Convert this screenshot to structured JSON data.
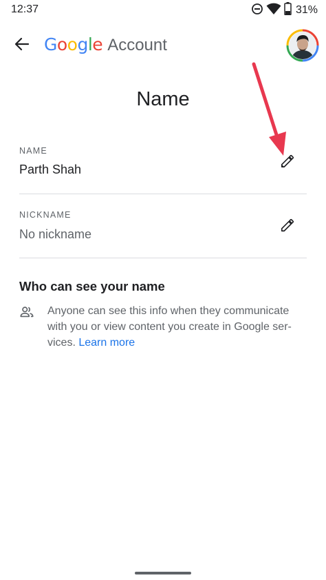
{
  "status_bar": {
    "time": "12:37",
    "battery_percent": "31%",
    "icons": [
      "do-not-disturb-icon",
      "wifi-icon",
      "battery-icon"
    ]
  },
  "app_bar": {
    "back_icon": "back-arrow-icon",
    "brand_letters": [
      {
        "char": "G",
        "color": "#4285F4"
      },
      {
        "char": "o",
        "color": "#EA4335"
      },
      {
        "char": "o",
        "color": "#FBBC05"
      },
      {
        "char": "g",
        "color": "#4285F4"
      },
      {
        "char": "l",
        "color": "#34A853"
      },
      {
        "char": "e",
        "color": "#EA4335"
      }
    ],
    "brand_suffix": "Account"
  },
  "page": {
    "title": "Name"
  },
  "fields": {
    "name": {
      "label": "NAME",
      "value": "Parth Shah",
      "edit_icon": "pencil-icon"
    },
    "nickname": {
      "label": "NICKNAME",
      "value": "No nickname",
      "edit_icon": "pencil-icon"
    }
  },
  "visibility": {
    "title": "Who can see your name",
    "icon": "people-icon",
    "text": "Anyone can see this info when they communicate with you or view content you create in Google ser­vices. ",
    "learn_more": "Learn more"
  },
  "annotation": {
    "arrow_color": "#E8384F"
  },
  "colors": {
    "text_primary": "#202124",
    "text_secondary": "#5f6368",
    "link": "#1a73e8",
    "divider": "#dadce0"
  }
}
